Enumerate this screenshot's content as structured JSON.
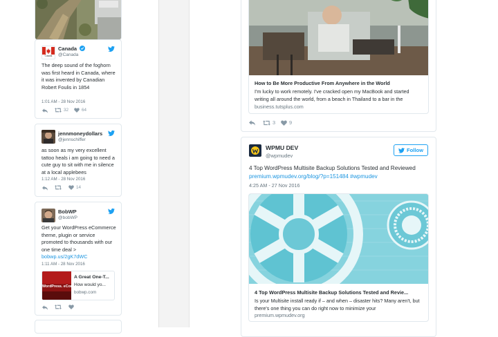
{
  "colors": {
    "twitter_blue": "#1da1f2",
    "link": "#1b95e0",
    "muted": "#66757f",
    "border": "#e1e8ed"
  },
  "left_tweets": [
    {
      "name": "Canada",
      "handle": "@Canada",
      "verified": true,
      "avatar_caption": "Canada",
      "text": "The deep sound of the foghorn was first heard in Canada, where it was invented by Canadian Robert Foulis in 1854",
      "timestamp": "1:01 AM - 28 Nov 2016",
      "retweets": "32",
      "likes": "64"
    },
    {
      "name": "jennmoneydollars",
      "handle": "@jennschiffer",
      "text": "as soon as my very excellent tattoo heals i am going to need a cute guy to sit with me in silence at a local applebees",
      "timestamp": "1:12 AM - 28 Nov 2016",
      "retweets": "",
      "likes": "14"
    },
    {
      "name": "BobWP",
      "handle": "@bobWP",
      "text_before_link": "Get your WordPress eCommerce theme, plugin or service promoted to thousands with our one time deal > ",
      "link": "bobwp.us/2gK7dWC",
      "timestamp": "1:11 AM - 28 Nov 2016",
      "card": {
        "image_text": "WordPress. eCom",
        "title": "A Great One-T...",
        "desc": "How would yo...",
        "url": "bobwp.com"
      }
    }
  ],
  "right_top": {
    "preview_title": "How to Be More Productive From Anywhere in the World",
    "preview_desc": "I'm lucky to work remotely. I've cracked open my MacBook and started writing all around the world, from a beach in Thailand to a bar in the",
    "preview_url": "business.tutsplus.com",
    "retweets": "3",
    "likes": "9"
  },
  "right_main": {
    "name": "WPMU DEV",
    "handle": "@wpmudev",
    "follow_label": "Follow",
    "text": "4 Top WordPress Multisite Backup Solutions Tested and Reviewed",
    "link": "premium.wpmudev.org/blog/?p=151484 #wpmudev",
    "timestamp": "4:25 AM - 27 Nov 2016",
    "preview_title": "4 Top WordPress Multisite Backup Solutions Tested and Revie...",
    "preview_desc": "Is your Multisite install ready if – and when – disaster hits? Many aren't, but there's one thing you can do right now to minimize your",
    "preview_url": "premium.wpmudev.org"
  }
}
